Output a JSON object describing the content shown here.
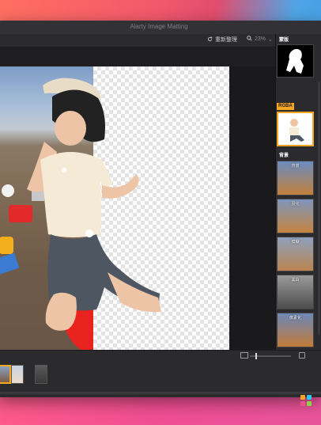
{
  "window": {
    "title": "Alarty Image Matting"
  },
  "toolbar": {
    "reset_label": "重新整理",
    "zoom": "23%"
  },
  "right_panel": {
    "mask_label": "蒙版",
    "rgba_label": "RGBA",
    "background_label": "背景",
    "effects": [
      {
        "label": "背景"
      },
      {
        "label": "羽化"
      },
      {
        "label": "模糊"
      },
      {
        "label": "黑白"
      },
      {
        "label": "像素化"
      }
    ]
  },
  "filmstrip": {
    "selected_index": 0,
    "thumbnails": [
      {
        "name": "thumb-1"
      },
      {
        "name": "thumb-2"
      },
      {
        "name": "thumb-3"
      }
    ]
  },
  "colors": {
    "accent": "#f5a623",
    "window_bg": "#2a2a2c",
    "desktop_pink": "#ef4e93",
    "desktop_blue": "#3b8fe0"
  }
}
